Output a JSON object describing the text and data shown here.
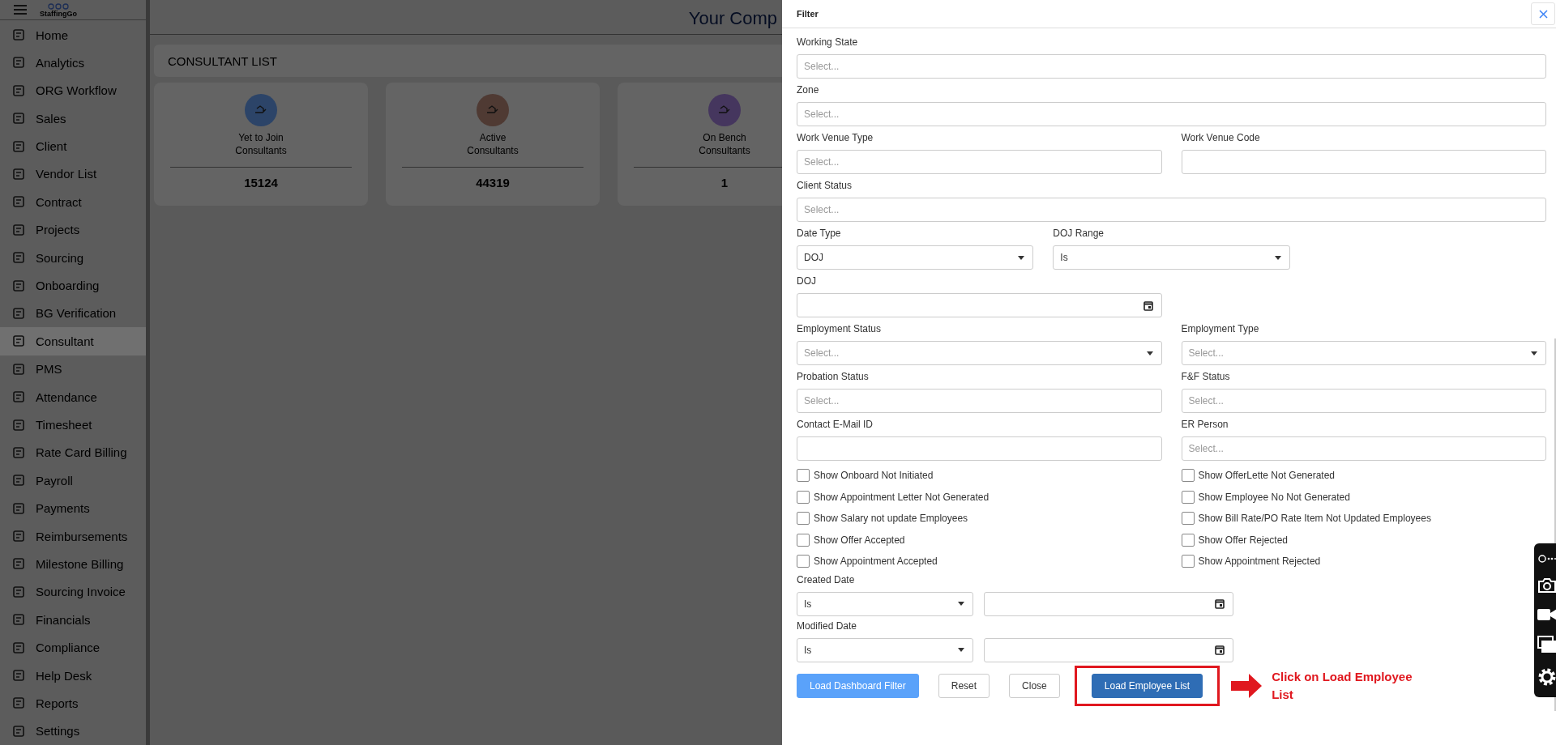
{
  "header": {
    "logo": "StaffingGo",
    "title": "Your Comp"
  },
  "sidebar": {
    "items": [
      {
        "label": "Home",
        "selected": false
      },
      {
        "label": "Analytics",
        "selected": false
      },
      {
        "label": "ORG Workflow",
        "selected": false
      },
      {
        "label": "Sales",
        "selected": false
      },
      {
        "label": "Client",
        "selected": false
      },
      {
        "label": "Vendor List",
        "selected": false
      },
      {
        "label": "Contract",
        "selected": false
      },
      {
        "label": "Projects",
        "selected": false
      },
      {
        "label": "Sourcing",
        "selected": false
      },
      {
        "label": "Onboarding",
        "selected": false
      },
      {
        "label": "BG Verification",
        "selected": false
      },
      {
        "label": "Consultant",
        "selected": true
      },
      {
        "label": "PMS",
        "selected": false
      },
      {
        "label": "Attendance",
        "selected": false
      },
      {
        "label": "Timesheet",
        "selected": false
      },
      {
        "label": "Rate Card Billing",
        "selected": false
      },
      {
        "label": "Payroll",
        "selected": false
      },
      {
        "label": "Payments",
        "selected": false
      },
      {
        "label": "Reimbursements",
        "selected": false
      },
      {
        "label": "Milestone Billing",
        "selected": false
      },
      {
        "label": "Sourcing Invoice",
        "selected": false
      },
      {
        "label": "Financials",
        "selected": false
      },
      {
        "label": "Compliance",
        "selected": false
      },
      {
        "label": "Help Desk",
        "selected": false
      },
      {
        "label": "Reports",
        "selected": false
      },
      {
        "label": "Settings",
        "selected": false
      }
    ]
  },
  "page_title": "CONSULTANT LIST",
  "cards": [
    {
      "label_lines": [
        "Yet to Join",
        "Consultants"
      ],
      "value": "15124",
      "color": "#2c4468"
    },
    {
      "label_lines": [
        "Active",
        "Consultants"
      ],
      "value": "44319",
      "color": "#4f3a33"
    },
    {
      "label_lines": [
        "On Bench",
        "Consultants"
      ],
      "value": "1",
      "color": "#45365e"
    }
  ],
  "filter": {
    "title": "Filter",
    "rows": [
      {
        "fields": [
          {
            "label": "Working State",
            "kind": "select",
            "placeholder": "Select..."
          }
        ]
      },
      {
        "fields": [
          {
            "label": "Zone",
            "kind": "select",
            "placeholder": "Select..."
          }
        ]
      },
      {
        "fields": [
          {
            "label": "Work Venue Type",
            "kind": "select",
            "placeholder": "Select..."
          },
          {
            "label": "Work Venue Code",
            "kind": "text"
          }
        ]
      },
      {
        "fields": [
          {
            "label": "Client Status",
            "kind": "select",
            "placeholder": "Select..."
          }
        ]
      },
      {
        "fields": [
          {
            "label": "Date Type",
            "kind": "dropdown",
            "value": "DOJ"
          },
          {
            "label": "DOJ Range",
            "kind": "dropdown",
            "value": "Is"
          }
        ]
      },
      {
        "fields": [
          {
            "label": "DOJ",
            "kind": "date"
          }
        ]
      },
      {
        "fields": [
          {
            "label": "Employment Status",
            "kind": "dropdown",
            "placeholder": "Select..."
          },
          {
            "label": "Employment Type",
            "kind": "dropdown",
            "placeholder": "Select..."
          }
        ]
      },
      {
        "fields": [
          {
            "label": "Probation Status",
            "kind": "select",
            "placeholder": "Select..."
          },
          {
            "label": "F&F Status",
            "kind": "select",
            "placeholder": "Select..."
          }
        ]
      },
      {
        "fields": [
          {
            "label": "Contact E-Mail ID",
            "kind": "text"
          },
          {
            "label": "ER Person",
            "kind": "select",
            "placeholder": "Select..."
          }
        ]
      }
    ],
    "checkboxes": [
      {
        "label": "Show Onboard Not Initiated",
        "checked": false
      },
      {
        "label": "Show OfferLette Not Generated",
        "checked": false
      },
      {
        "label": "Show Appointment Letter Not Generated",
        "checked": false
      },
      {
        "label": "Show Employee No Not Generated",
        "checked": false
      },
      {
        "label": "Show Salary not update Employees",
        "checked": false
      },
      {
        "label": "Show Bill Rate/PO Rate Item Not Updated Employees",
        "checked": false
      },
      {
        "label": "Show Offer Accepted",
        "checked": false
      },
      {
        "label": "Show Offer Rejected",
        "checked": false
      },
      {
        "label": "Show Appointment Accepted",
        "checked": false
      },
      {
        "label": "Show Appointment Rejected",
        "checked": false
      }
    ],
    "date_filters": [
      {
        "label": "Created Date",
        "operator": "Is"
      },
      {
        "label": "Modified Date",
        "operator": "Is"
      }
    ],
    "buttons": [
      {
        "label": "Load Dashboard Filter",
        "kind": "primary"
      },
      {
        "label": "Reset",
        "kind": "outline"
      },
      {
        "label": "Close",
        "kind": "outline"
      },
      {
        "label": "Load Employee List",
        "kind": "highlighted"
      }
    ]
  },
  "annotation": {
    "text": "Click on Load Employee List"
  }
}
